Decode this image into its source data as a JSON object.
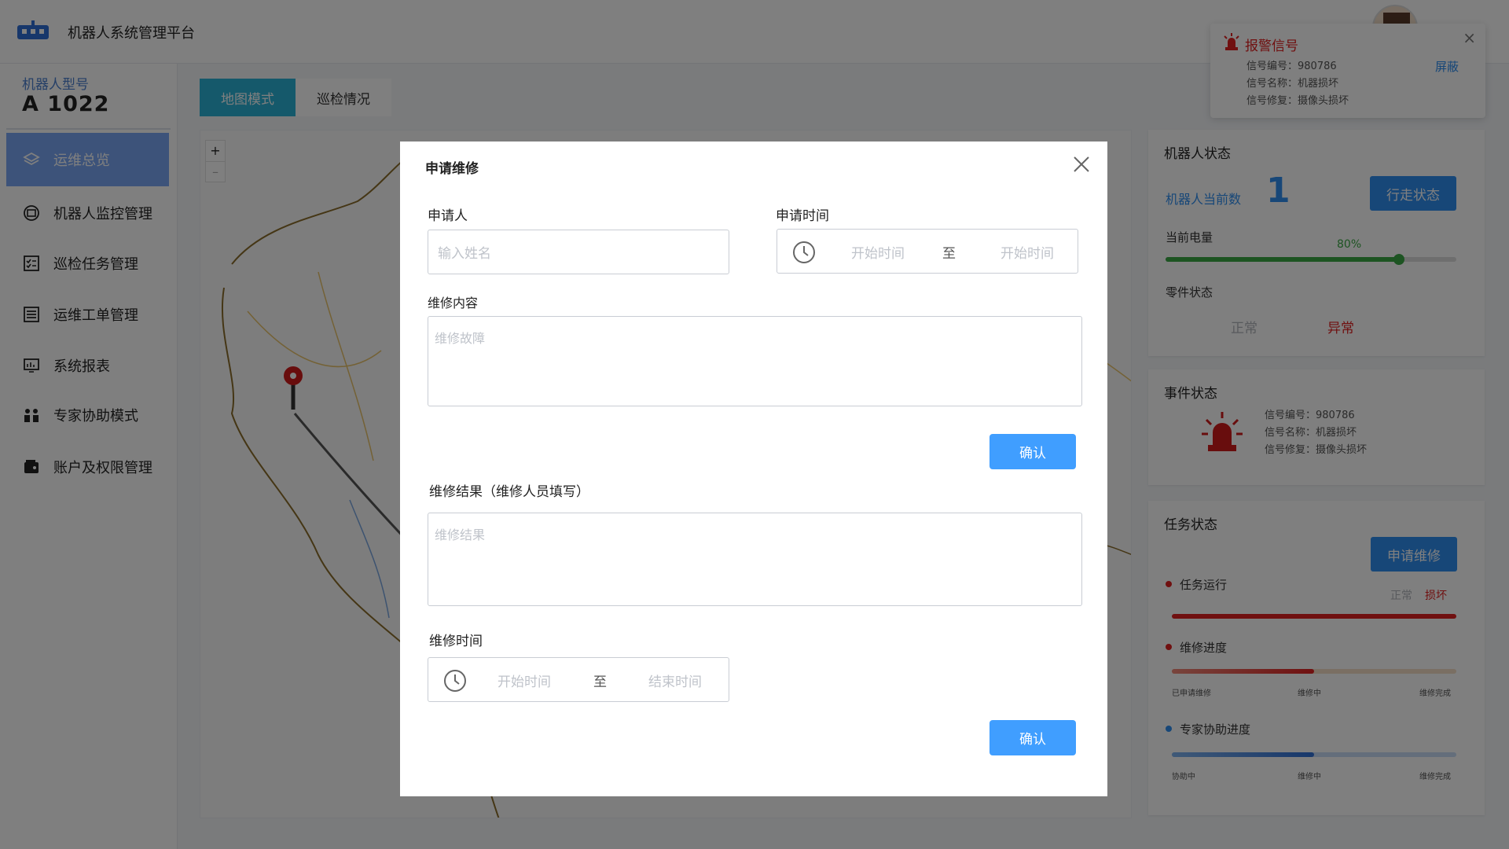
{
  "app": {
    "title": "机器人系统管理平台"
  },
  "sidebar": {
    "model_label": "机器人型号",
    "model_value": "A 1022",
    "items": [
      {
        "label": "运维总览",
        "icon": "layers-icon"
      },
      {
        "label": "机器人监控管理",
        "icon": "monitor-target-icon"
      },
      {
        "label": "巡检任务管理",
        "icon": "checklist-icon"
      },
      {
        "label": "运维工单管理",
        "icon": "list-icon"
      },
      {
        "label": "系统报表",
        "icon": "report-screen-icon"
      },
      {
        "label": "专家协助模式",
        "icon": "people-icon"
      },
      {
        "label": "账户及权限管理",
        "icon": "wallet-icon"
      }
    ]
  },
  "tabs": [
    {
      "label": "地图模式"
    },
    {
      "label": "巡检情况"
    }
  ],
  "map": {
    "zoom_in": "+",
    "zoom_out": "–"
  },
  "alert": {
    "title": "报警信号",
    "lines": [
      "信号编号：980786",
      "信号名称：机器损坏",
      "信号修复：摄像头损坏"
    ],
    "mask_label": "屏蔽"
  },
  "robot_status": {
    "title": "机器人状态",
    "count_label": "机器人当前数",
    "count_value": "1",
    "walk_button": "行走状态",
    "battery_label": "当前电量",
    "battery_percent_text": "80%",
    "battery_level": 0.8,
    "parts_label": "零件状态",
    "parts_normal": "正常",
    "parts_abnormal": "异常"
  },
  "event_status": {
    "title": "事件状态",
    "lines": [
      "信号编号：980786",
      "信号名称：机器损坏",
      "信号修复：摄像头损坏"
    ]
  },
  "task_status": {
    "title": "任务状态",
    "apply_button": "申请维修",
    "task_run": {
      "label": "任务运行",
      "normal": "正常",
      "broken": "损坏"
    },
    "repair_progress": {
      "label": "维修进度",
      "steps": [
        "已申请维修",
        "维修中",
        "维修完成"
      ],
      "level": 0.5
    },
    "expert_progress": {
      "label": "专家协助进度",
      "steps": [
        "协助中",
        "维修中",
        "维修完成"
      ],
      "level": 0.5
    }
  },
  "modal": {
    "title": "申请维修",
    "applicant_label": "申请人",
    "applicant_placeholder": "输入姓名",
    "apply_time_label": "申请时间",
    "apply_time_start": "开始时间",
    "apply_time_sep": "至",
    "apply_time_end": "开始时间",
    "content_label": "维修内容",
    "content_placeholder": "维修故障",
    "confirm1": "确认",
    "result_label": "维修结果（维修人员填写）",
    "result_placeholder": "维修结果",
    "repair_time_label": "维修时间",
    "repair_time_start": "开始时间",
    "repair_time_sep": "至",
    "repair_time_end": "结束时间",
    "confirm2": "确认"
  },
  "colors": {
    "accent": "#409eff",
    "alert": "#e02020",
    "battery": "#3aa845",
    "sidebar_active": "#7aa7f5",
    "tab_active": "#2bb3d6"
  }
}
